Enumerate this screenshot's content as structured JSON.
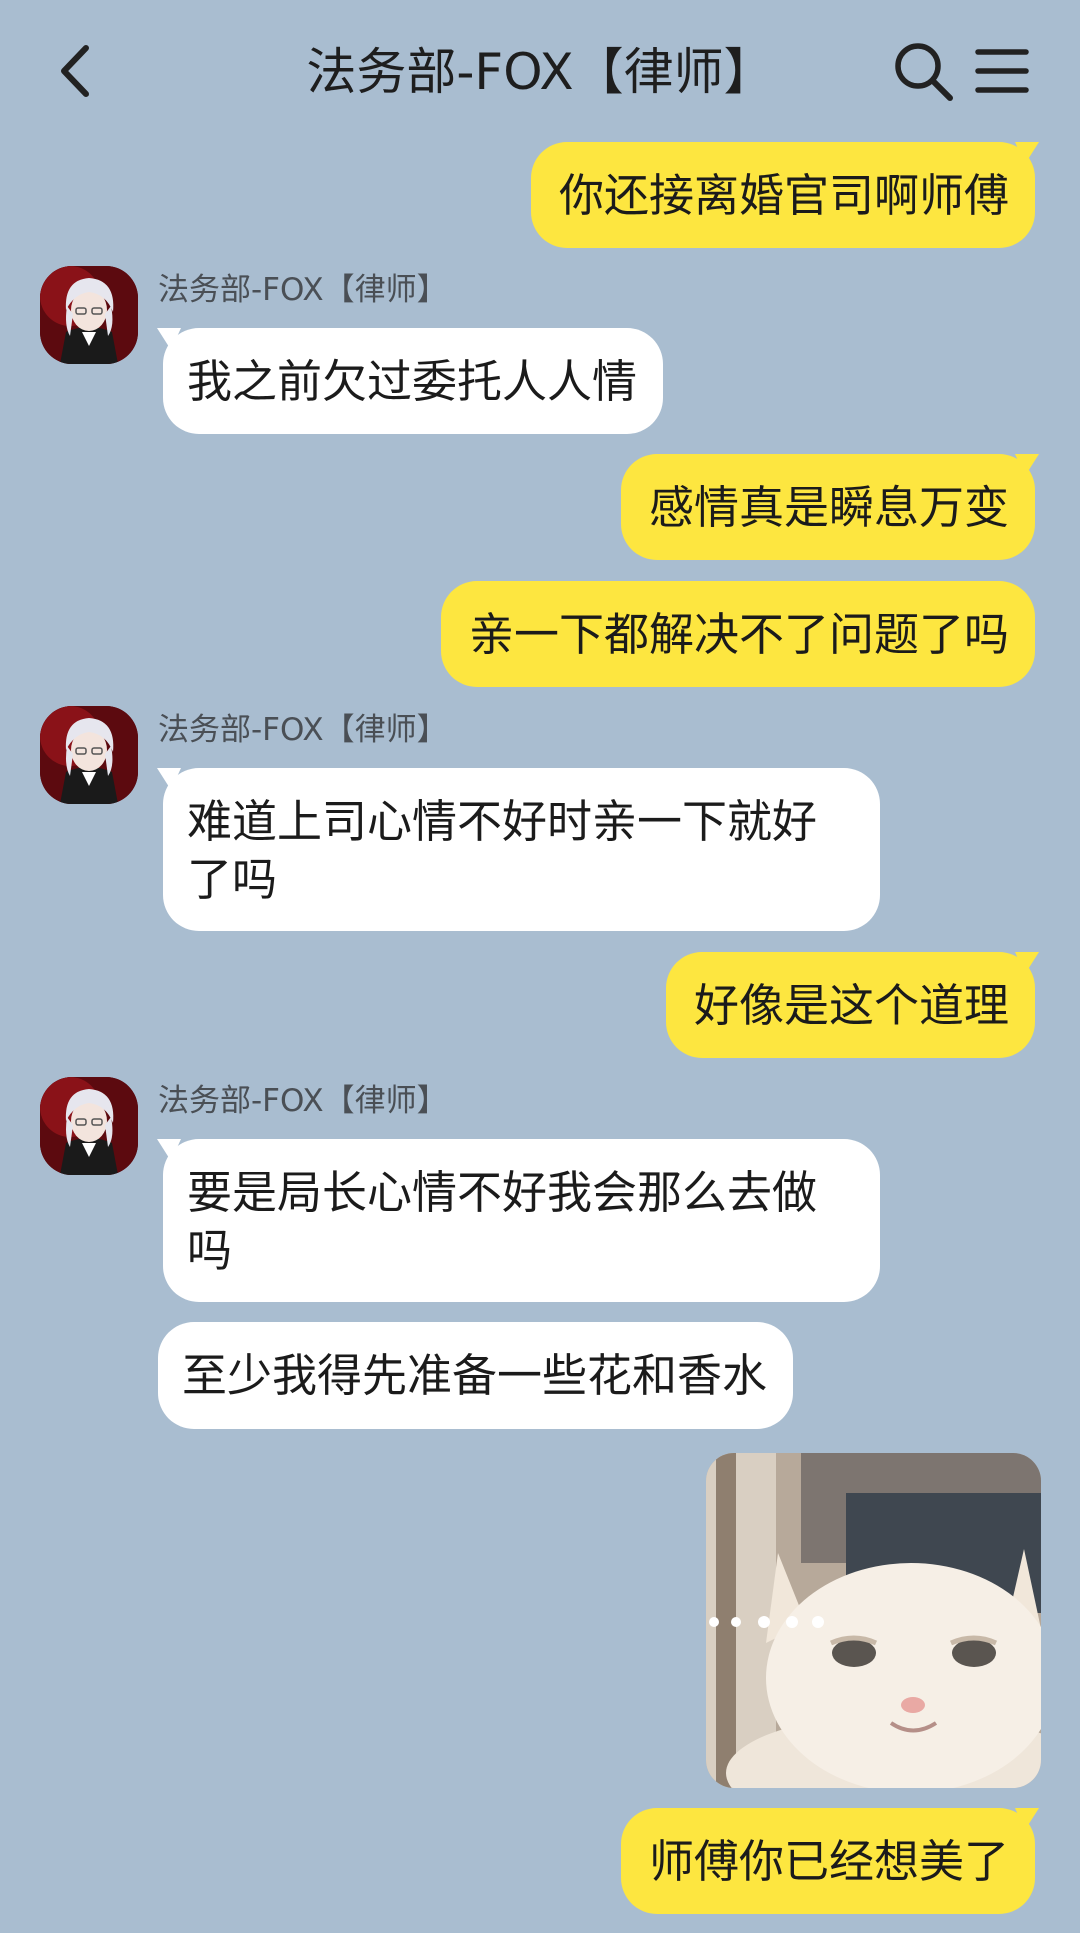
{
  "header": {
    "title": "法务部-FOX【律师】",
    "back_icon": "chevron-left-icon",
    "search_icon": "search-icon",
    "menu_icon": "hamburger-menu-icon"
  },
  "colors": {
    "background": "#a9bdd0",
    "my_bubble": "#fde640",
    "their_bubble": "#ffffff"
  },
  "messages": [
    {
      "from": "me",
      "text": "你还接离婚官司啊师傅"
    },
    {
      "from": "them",
      "sender": "法务部-FOX【律师】",
      "text": "我之前欠过委托人人情"
    },
    {
      "from": "me",
      "text": "感情真是瞬息万变"
    },
    {
      "from": "me",
      "text": "亲一下都解决不了问题了吗"
    },
    {
      "from": "them",
      "sender": "法务部-FOX【律师】",
      "text": "难道上司心情不好时亲一下就好了吗"
    },
    {
      "from": "me",
      "text": "好像是这个道理"
    },
    {
      "from": "them",
      "sender": "法务部-FOX【律师】",
      "text": "要是局长心情不好我会那么去做吗"
    },
    {
      "from": "them",
      "text": "至少我得先准备一些花和香水"
    },
    {
      "from": "me",
      "type": "sticker",
      "sticker": "smiling-white-cat-sticker"
    },
    {
      "from": "me",
      "text": "师傅你已经想美了"
    }
  ]
}
